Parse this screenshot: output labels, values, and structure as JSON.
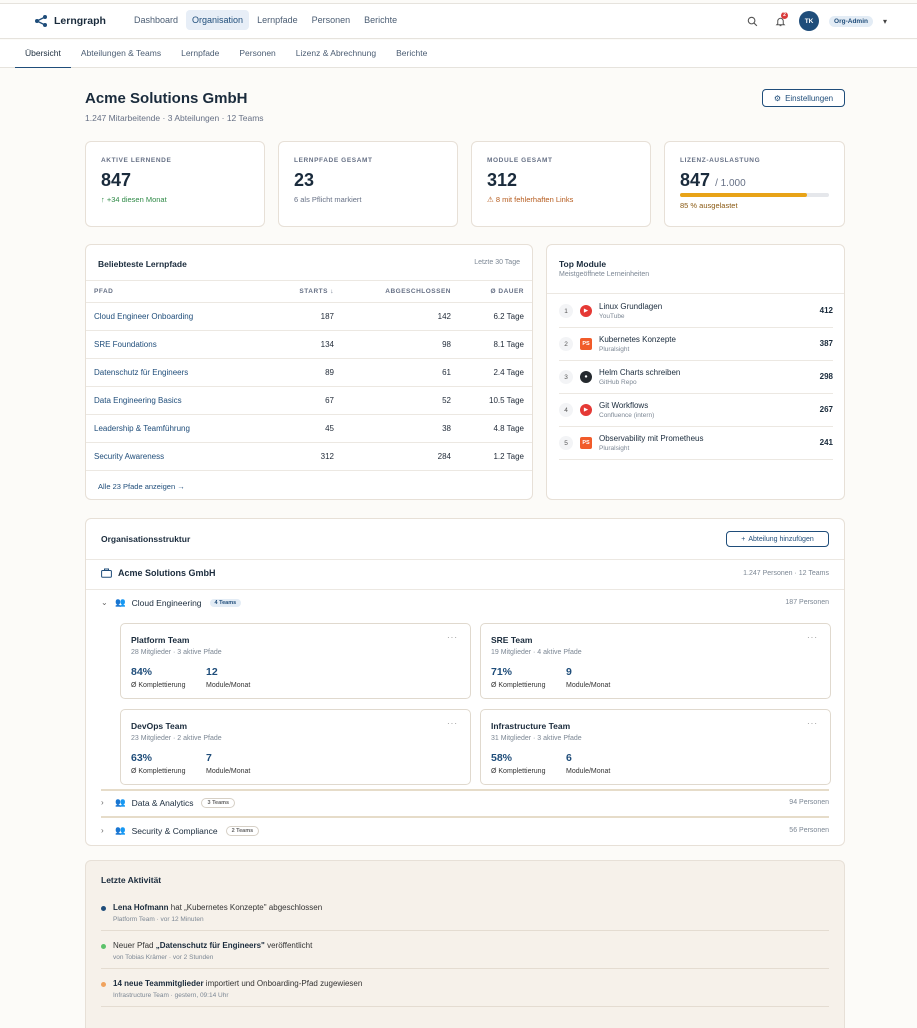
{
  "app": {
    "name": "Lerngraph"
  },
  "nav": [
    "Dashboard",
    "Organisation",
    "Lernpfade",
    "Personen",
    "Berichte"
  ],
  "notifications": {
    "count": "2"
  },
  "user": {
    "initials": "TK",
    "role": "Org-Admin"
  },
  "subnav": [
    "Übersicht",
    "Abteilungen & Teams",
    "Lernpfade",
    "Personen",
    "Lizenz & Abrechnung",
    "Berichte"
  ],
  "org": {
    "name": "Acme Solutions GmbH",
    "summary": [
      "1.247 Mitarbeitende",
      "3 Abteilungen",
      "12 Teams"
    ],
    "settings_label": "Einstellungen"
  },
  "stats": [
    {
      "label": "AKTIVE LERNENDE",
      "value": "847",
      "note": "+34 diesen Monat"
    },
    {
      "label": "LERNPFADE GESAMT",
      "value": "23",
      "note": "6 als Pflicht markiert"
    },
    {
      "label": "MODULE GESAMT",
      "value": "312",
      "note": "8 mit fehlerhaften Links"
    },
    {
      "label": "LIZENZ-AUSLASTUNG",
      "value": "847",
      "total": "/ 1.000",
      "progress_fraction": 0.85,
      "note": "85 % ausgelastet"
    }
  ],
  "popular_paths": {
    "title": "Beliebteste Lernpfade",
    "period": "Letzte 30 Tage",
    "columns": [
      "PFAD",
      "STARTS ↓",
      "ABGESCHLOSSEN",
      "Ø DAUER"
    ],
    "rows": [
      [
        "Cloud Engineer Onboarding",
        "187",
        "142",
        "6.2 Tage"
      ],
      [
        "SRE Foundations",
        "134",
        "98",
        "8.1 Tage"
      ],
      [
        "Datenschutz für Engineers",
        "89",
        "61",
        "2.4 Tage"
      ],
      [
        "Data Engineering Basics",
        "67",
        "52",
        "10.5 Tage"
      ],
      [
        "Leadership & Teamführung",
        "45",
        "38",
        "4.8 Tage"
      ],
      [
        "Security Awareness",
        "312",
        "284",
        "1.2 Tage"
      ]
    ],
    "more_link": "Alle 23 Pfade anzeigen →"
  },
  "top_modules": {
    "title": "Top Module",
    "subtitle": "Meistgeöffnete Lerneinheiten",
    "items": [
      {
        "rank": "1",
        "title": "Linux Grundlagen",
        "source": "YouTube",
        "count": "412",
        "icon": "youtube-icon"
      },
      {
        "rank": "2",
        "title": "Kubernetes Konzepte",
        "source": "Pluralsight",
        "count": "387",
        "icon": "pluralsight-icon",
        "icon_text": "PS"
      },
      {
        "rank": "3",
        "title": "Helm Charts schreiben",
        "source": "GitHub Repo",
        "count": "298",
        "icon": "github-icon"
      },
      {
        "rank": "4",
        "title": "Git Workflows",
        "source": "Confluence (intern)",
        "count": "267",
        "icon": "youtube-icon"
      },
      {
        "rank": "5",
        "title": "Observability mit Prometheus",
        "source": "Pluralsight",
        "count": "241",
        "icon": "pluralsight-icon",
        "icon_text": "PS"
      }
    ]
  },
  "structure": {
    "title": "Organisationsstruktur",
    "add_label": "Abteilung hinzufügen",
    "root": {
      "name": "Acme Solutions GmbH",
      "meta": "1.247 Personen · 12 Teams"
    },
    "departments": [
      {
        "name": "Cloud Engineering",
        "teams_label": "4 Teams",
        "people": "187 Personen",
        "expanded": true,
        "teams": [
          {
            "name": "Platform Team",
            "sub": "28 Mitglieder · 3 aktive Pfade",
            "completion": "84%",
            "completion_label": "Ø Komplettierung",
            "modules": "12",
            "modules_label": "Module/Monat"
          },
          {
            "name": "SRE Team",
            "sub": "19 Mitglieder · 4 aktive Pfade",
            "completion": "71%",
            "completion_label": "Ø Komplettierung",
            "modules": "9",
            "modules_label": "Module/Monat"
          },
          {
            "name": "DevOps Team",
            "sub": "23 Mitglieder · 2 aktive Pfade",
            "completion": "63%",
            "completion_label": "Ø Komplettierung",
            "modules": "7",
            "modules_label": "Module/Monat"
          },
          {
            "name": "Infrastructure Team",
            "sub": "31 Mitglieder · 3 aktive Pfade",
            "completion": "58%",
            "completion_label": "Ø Komplettierung",
            "modules": "6",
            "modules_label": "Module/Monat"
          }
        ]
      },
      {
        "name": "Data & Analytics",
        "teams_label": "3 Teams",
        "people": "94 Personen",
        "expanded": false
      },
      {
        "name": "Security & Compliance",
        "teams_label": "2 Teams",
        "people": "56 Personen",
        "expanded": false
      }
    ]
  },
  "activity": {
    "title": "Letzte Aktivität",
    "items": [
      {
        "pre": "",
        "bold": "Lena Hofmann",
        "post": " hat „Kubernetes Konzepte\" abgeschlossen",
        "meta": "Platform Team · vor 12 Minuten",
        "color": "#1f4d7a"
      },
      {
        "pre": "Neuer Pfad ",
        "bold": "„Datenschutz für Engineers\"",
        "post": " veröffentlicht",
        "meta": "von Tobias Krämer · vor 2 Stunden",
        "color": "#5cc26a"
      },
      {
        "pre": "",
        "bold": "14 neue Teammitglieder",
        "post": " importiert und Onboarding-Pfad zugewiesen",
        "meta": "Infrastructure Team · gestern, 09:14 Uhr",
        "color": "#f0a35e"
      }
    ]
  },
  "colors": {
    "accent": "#1f4d7a",
    "warning": "#e8a317",
    "success": "#2f8a47"
  }
}
